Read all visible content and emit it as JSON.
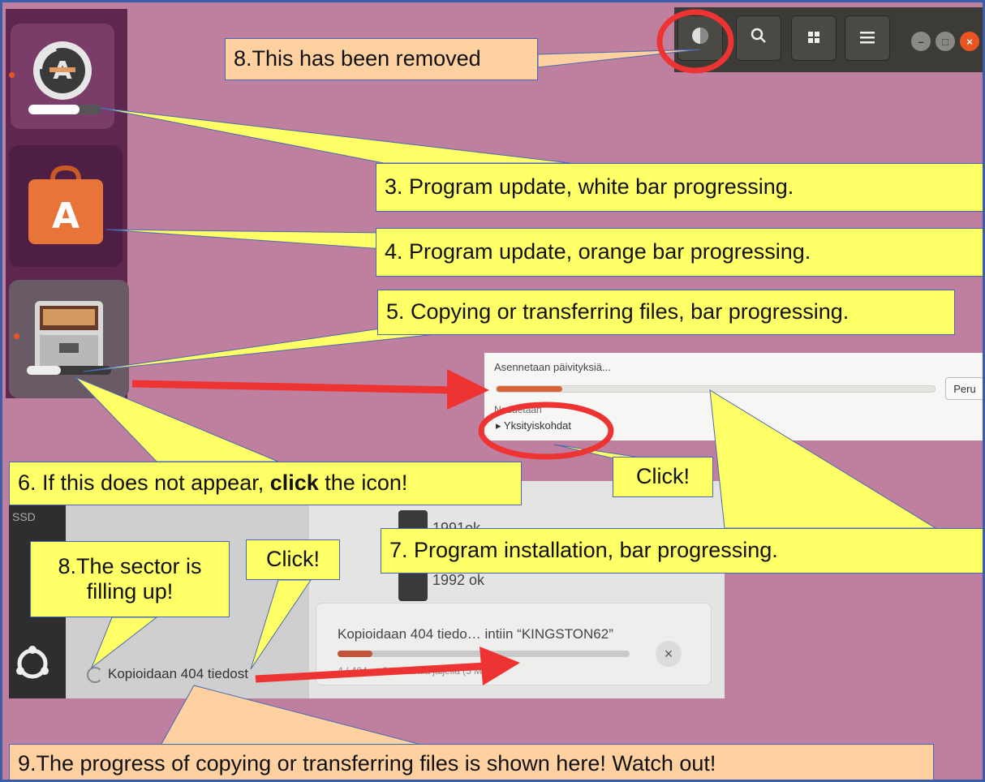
{
  "background_color": "#bf80a0",
  "callouts": {
    "removed": "8.This has been removed",
    "program_update_white": "3. Program update, white bar progressing.",
    "program_update_orange": "4. Program update, orange bar progressing.",
    "copying_files": "5. Copying or transferring files, bar progressing.",
    "if_not_appear_pre": "6. If this does not appear, ",
    "if_not_appear_bold": "click",
    "if_not_appear_post": " the icon!",
    "click_details": "Click!",
    "program_installation": "7. Program installation, bar progressing.",
    "sector_filling": "8.The sector is filling up!",
    "click_sidebar": "Click!",
    "progress_shown": "9.The progress of copying or transferring files is shown here! Watch out!"
  },
  "launcher": {
    "icons": [
      {
        "name": "software-updater-icon",
        "progress": 0.7
      },
      {
        "name": "ubuntu-software-icon"
      },
      {
        "name": "files-icon",
        "progress": 0.4
      }
    ]
  },
  "topbar": {
    "buttons": [
      "pie-progress-icon",
      "search-icon",
      "grid-icon",
      "menu-icon"
    ],
    "window_controls": [
      "minimize-icon",
      "maximize-icon",
      "close-icon"
    ]
  },
  "install_panel": {
    "title": "Asennetaan päivityksiä...",
    "cancel_label": "Peru",
    "status": "Noudetaan",
    "details_label": "Yksityiskohdat",
    "progress": 0.15
  },
  "file_manager": {
    "folders": [
      "1991ok",
      "1992 ok"
    ],
    "sidebar_operation": "Kopioidaan 404 tiedost",
    "copy_title": "Kopioidaan 404 tiedo… intiin “KINGSTON62”",
    "copy_status": "4 / 404 — 8 minuuttia jäljellä (5 Mt/s)",
    "copy_progress": 0.12,
    "close_label": "×",
    "side_label": "SSD"
  },
  "colors": {
    "callout_yellow": "#ffff66",
    "callout_peach": "#ffd0a0",
    "red": "#ee3333",
    "border_blue": "#3a5ea8"
  }
}
